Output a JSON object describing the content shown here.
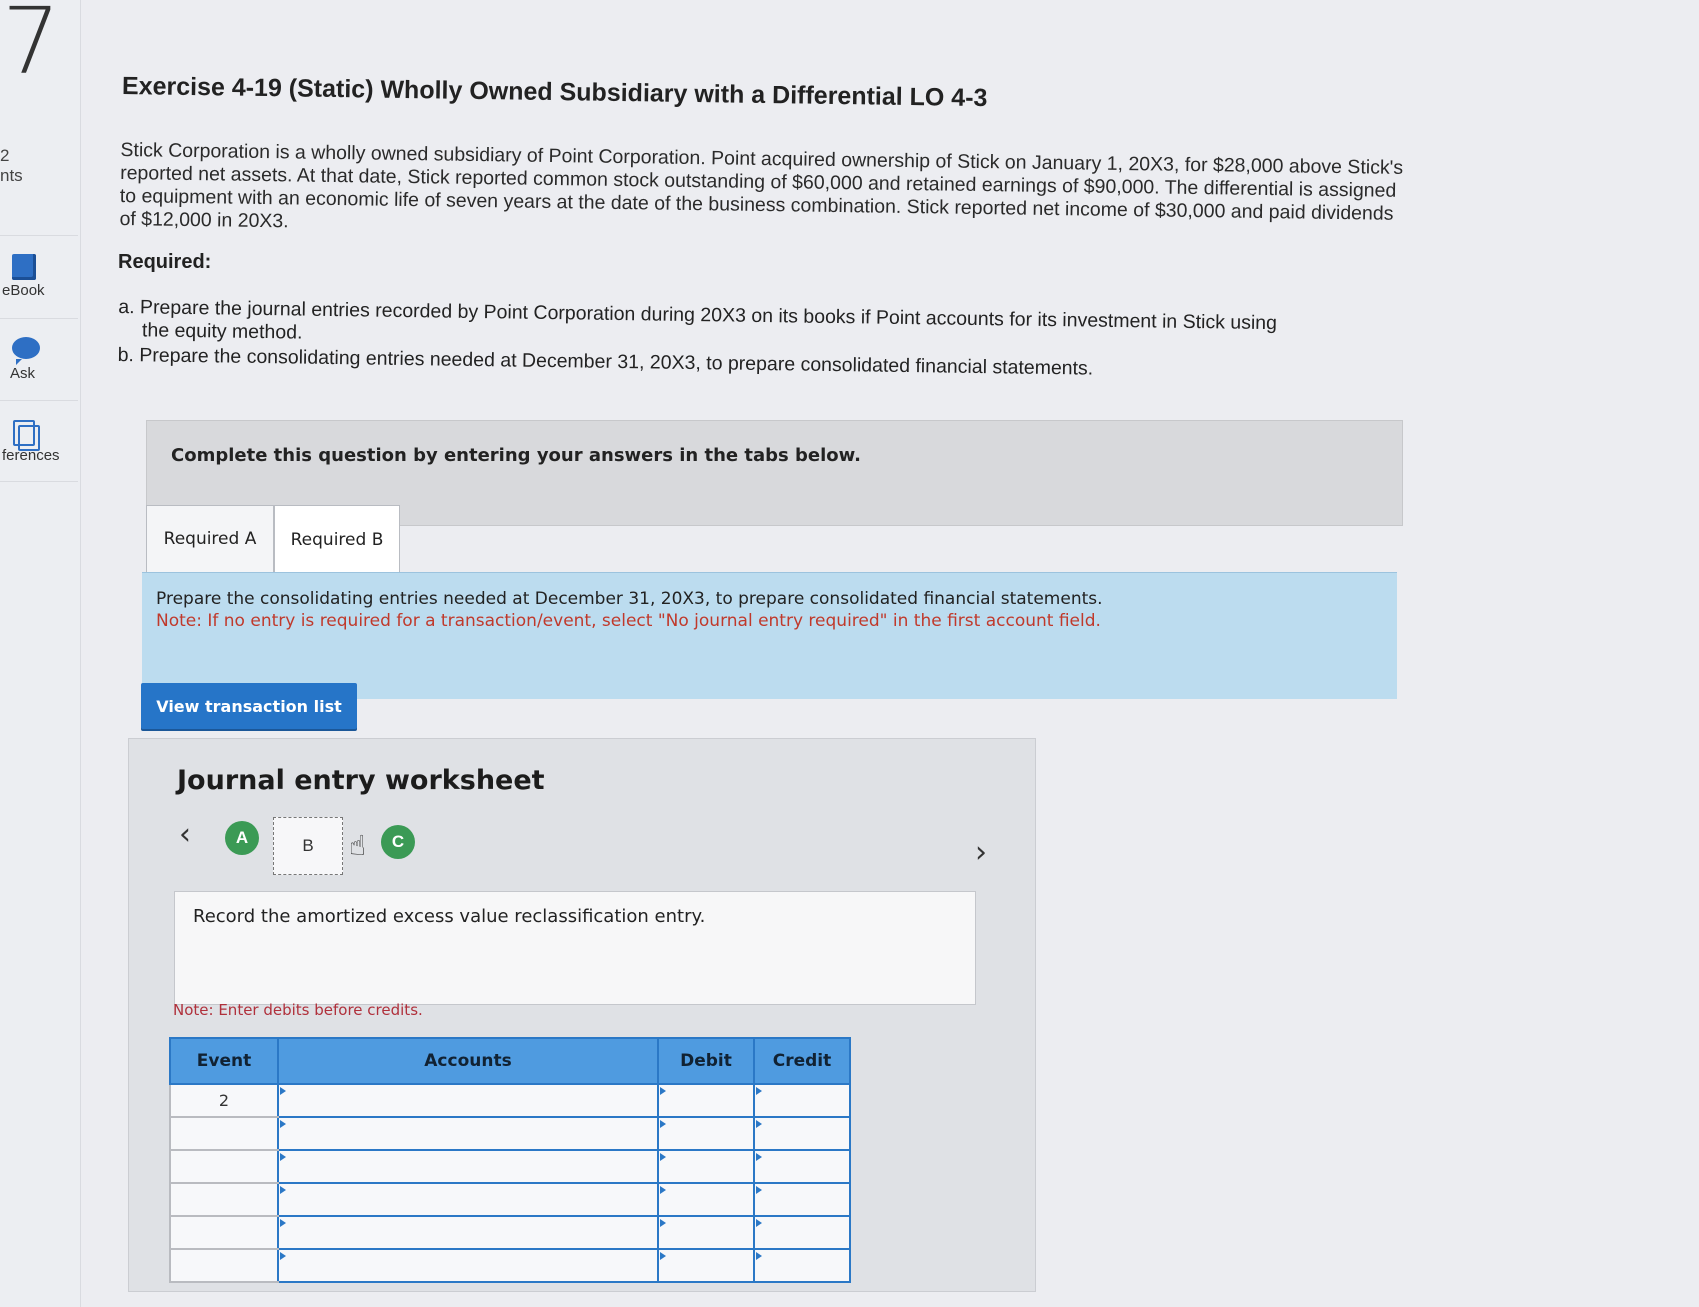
{
  "rail": {
    "question_number": "7",
    "points_value": "2",
    "points_label": "nts",
    "items": [
      {
        "label": "eBook",
        "icon": "book-icon"
      },
      {
        "label": "Ask",
        "icon": "chat-bubble-icon"
      },
      {
        "label": "ferences",
        "icon": "references-icon"
      }
    ]
  },
  "exercise": {
    "title": "Exercise 4-19 (Static) Wholly Owned Subsidiary with a Differential LO 4-3",
    "intro": "Stick Corporation is a wholly owned subsidiary of Point Corporation. Point acquired ownership of Stick on January 1, 20X3, for $28,000 above Stick's reported net assets. At that date, Stick reported common stock outstanding of $60,000 and retained earnings of $90,000. The differential is assigned to equipment with an economic life of seven years at the date of the business combination. Stick reported net income of $30,000 and paid dividends of $12,000 in 20X3.",
    "required_heading": "Required:",
    "req_a": "a. Prepare the journal entries recorded by Point Corporation during 20X3 on its books if Point accounts for its investment in Stick using the equity method.",
    "req_b": "b. Prepare the consolidating entries needed at December 31, 20X3, to prepare consolidated financial statements."
  },
  "complete_banner": "Complete this question by entering your answers in the tabs below.",
  "tabs": [
    {
      "label": "Required A",
      "active": false
    },
    {
      "label": "Required B",
      "active": true
    }
  ],
  "instructions": {
    "line1": "Prepare the consolidating entries needed at December 31, 20X3, to prepare consolidated financial statements.",
    "note": "Note: If no entry is required for a transaction/event, select \"No journal entry required\" in the first account field."
  },
  "view_button": "View transaction list",
  "worksheet": {
    "title": "Journal entry worksheet",
    "steps": [
      "A",
      "B",
      "C"
    ],
    "current_step": "B",
    "record_text": "Record the amortized excess value reclassification entry.",
    "note": "Note: Enter debits before credits.",
    "columns": [
      "Event",
      "Accounts",
      "Debit",
      "Credit"
    ],
    "rows": [
      {
        "event": "2",
        "account": "",
        "debit": "",
        "credit": ""
      },
      {
        "event": "",
        "account": "",
        "debit": "",
        "credit": ""
      },
      {
        "event": "",
        "account": "",
        "debit": "",
        "credit": ""
      },
      {
        "event": "",
        "account": "",
        "debit": "",
        "credit": ""
      },
      {
        "event": "",
        "account": "",
        "debit": "",
        "credit": ""
      },
      {
        "event": "",
        "account": "",
        "debit": "",
        "credit": ""
      }
    ]
  },
  "colors": {
    "accent_blue": "#2675c8",
    "step_green": "#3b9a55",
    "note_red": "#c0392b",
    "instruction_bg": "#bcdcef"
  }
}
